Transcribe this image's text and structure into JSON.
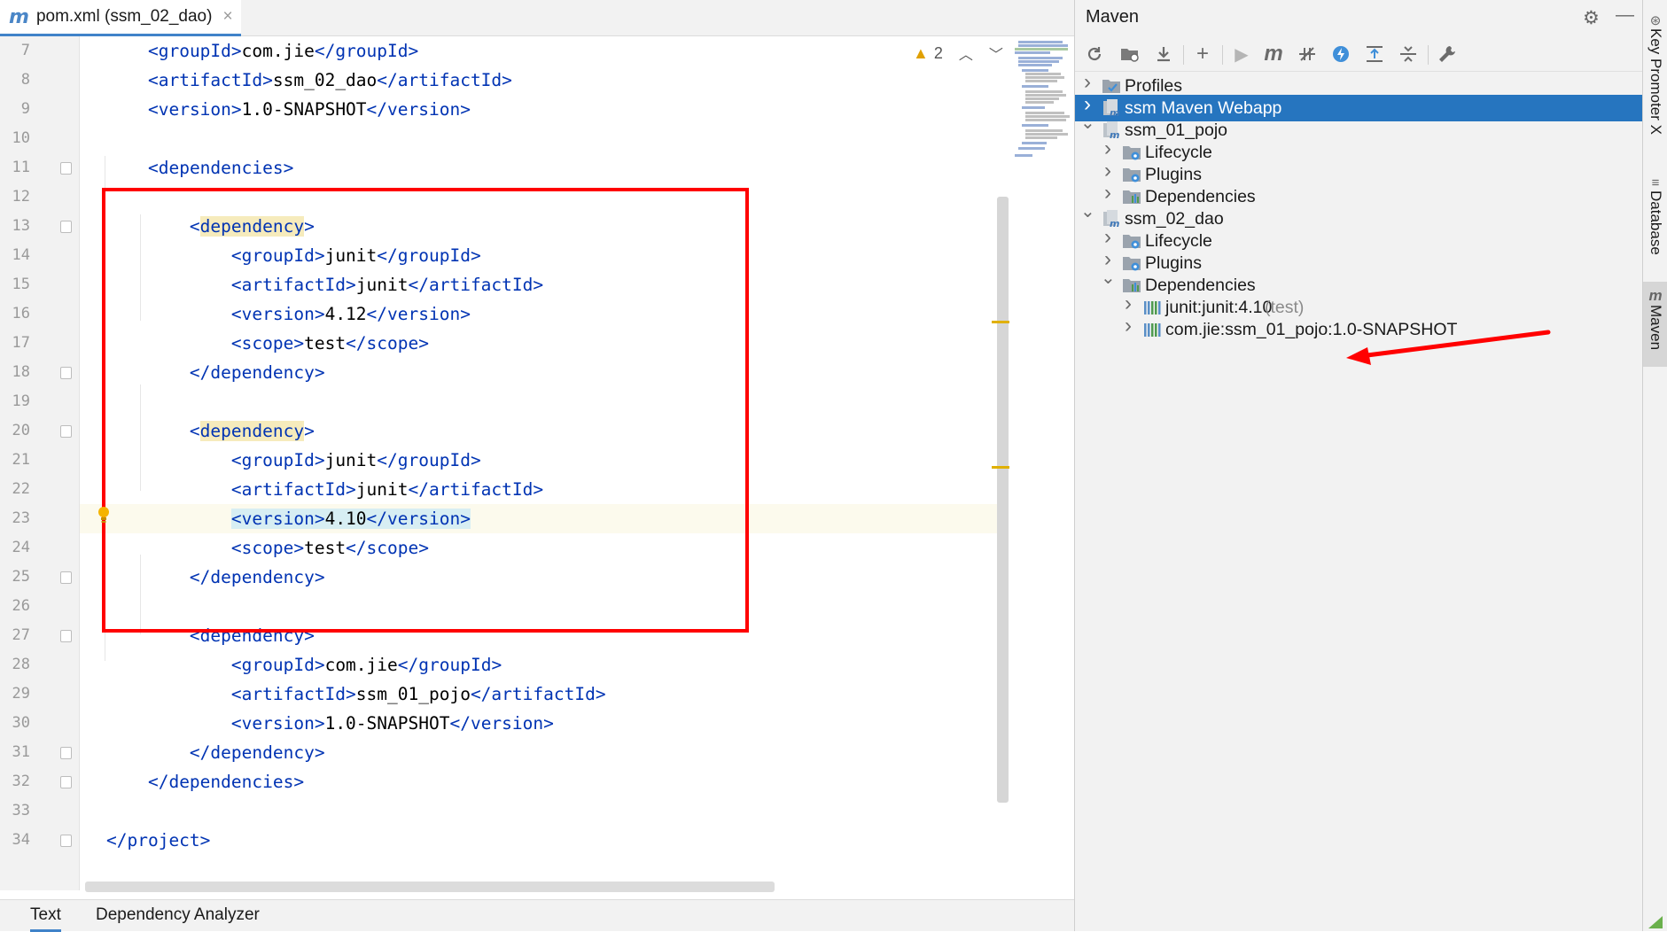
{
  "editor": {
    "tab": {
      "title": "pom.xml (ssm_02_dao)",
      "icon": "maven-m-icon",
      "close": "×"
    },
    "inspections": {
      "warning_count": "2"
    },
    "current_line": 23,
    "lines": [
      {
        "n": "7",
        "code": "    <groupId>com.jie</groupId>"
      },
      {
        "n": "8",
        "code": "    <artifactId>ssm_02_dao</artifactId>"
      },
      {
        "n": "9",
        "code": "    <version>1.0-SNAPSHOT</version>"
      },
      {
        "n": "10",
        "code": ""
      },
      {
        "n": "11",
        "code": "    <dependencies>"
      },
      {
        "n": "12",
        "code": ""
      },
      {
        "n": "13",
        "code": "        <dependency>"
      },
      {
        "n": "14",
        "code": "            <groupId>junit</groupId>"
      },
      {
        "n": "15",
        "code": "            <artifactId>junit</artifactId>"
      },
      {
        "n": "16",
        "code": "            <version>4.12</version>"
      },
      {
        "n": "17",
        "code": "            <scope>test</scope>"
      },
      {
        "n": "18",
        "code": "        </dependency>"
      },
      {
        "n": "19",
        "code": ""
      },
      {
        "n": "20",
        "code": "        <dependency>"
      },
      {
        "n": "21",
        "code": "            <groupId>junit</groupId>"
      },
      {
        "n": "22",
        "code": "            <artifactId>junit</artifactId>"
      },
      {
        "n": "23",
        "code": "            <version>4.10</version>"
      },
      {
        "n": "24",
        "code": "            <scope>test</scope>"
      },
      {
        "n": "25",
        "code": "        </dependency>"
      },
      {
        "n": "26",
        "code": ""
      },
      {
        "n": "27",
        "code": "        <dependency>"
      },
      {
        "n": "28",
        "code": "            <groupId>com.jie</groupId>"
      },
      {
        "n": "29",
        "code": "            <artifactId>ssm_01_pojo</artifactId>"
      },
      {
        "n": "30",
        "code": "            <version>1.0-SNAPSHOT</version>"
      },
      {
        "n": "31",
        "code": "        </dependency>"
      },
      {
        "n": "32",
        "code": "    </dependencies>"
      },
      {
        "n": "33",
        "code": ""
      },
      {
        "n": "34",
        "code": "</project>"
      }
    ],
    "bottom_tabs": [
      "Text",
      "Dependency Analyzer"
    ]
  },
  "maven": {
    "title": "Maven",
    "tree": [
      {
        "label": "Profiles",
        "indent": 0,
        "arrow": "›",
        "icon": "profiles-icon"
      },
      {
        "label": "ssm Maven Webapp",
        "indent": 0,
        "arrow": "›",
        "icon": "maven-module-icon",
        "selected": true
      },
      {
        "label": "ssm_01_pojo",
        "indent": 0,
        "arrow": "⌄",
        "icon": "maven-module-icon"
      },
      {
        "label": "Lifecycle",
        "indent": 1,
        "arrow": "›",
        "icon": "lifecycle-folder-icon"
      },
      {
        "label": "Plugins",
        "indent": 1,
        "arrow": "›",
        "icon": "plugins-folder-icon"
      },
      {
        "label": "Dependencies",
        "indent": 1,
        "arrow": "›",
        "icon": "dependencies-folder-icon"
      },
      {
        "label": "ssm_02_dao",
        "indent": 0,
        "arrow": "⌄",
        "icon": "maven-module-icon"
      },
      {
        "label": "Lifecycle",
        "indent": 1,
        "arrow": "›",
        "icon": "lifecycle-folder-icon"
      },
      {
        "label": "Plugins",
        "indent": 1,
        "arrow": "›",
        "icon": "plugins-folder-icon"
      },
      {
        "label": "Dependencies",
        "indent": 1,
        "arrow": "⌄",
        "icon": "dependencies-folder-icon"
      },
      {
        "label": "junit:junit:4.10",
        "suffix": "(test)",
        "indent": 2,
        "arrow": "›",
        "icon": "library-icon"
      },
      {
        "label": "com.jie:ssm_01_pojo:1.0-SNAPSHOT",
        "indent": 2,
        "arrow": "›",
        "icon": "library-icon"
      }
    ]
  },
  "side_strip": {
    "tools": [
      "Key Promoter X",
      "Database",
      "Maven"
    ]
  },
  "colors": {
    "annotation_red": "#ff0000",
    "selection_blue": "#2675bf",
    "xml_tag": "#0033b3"
  }
}
